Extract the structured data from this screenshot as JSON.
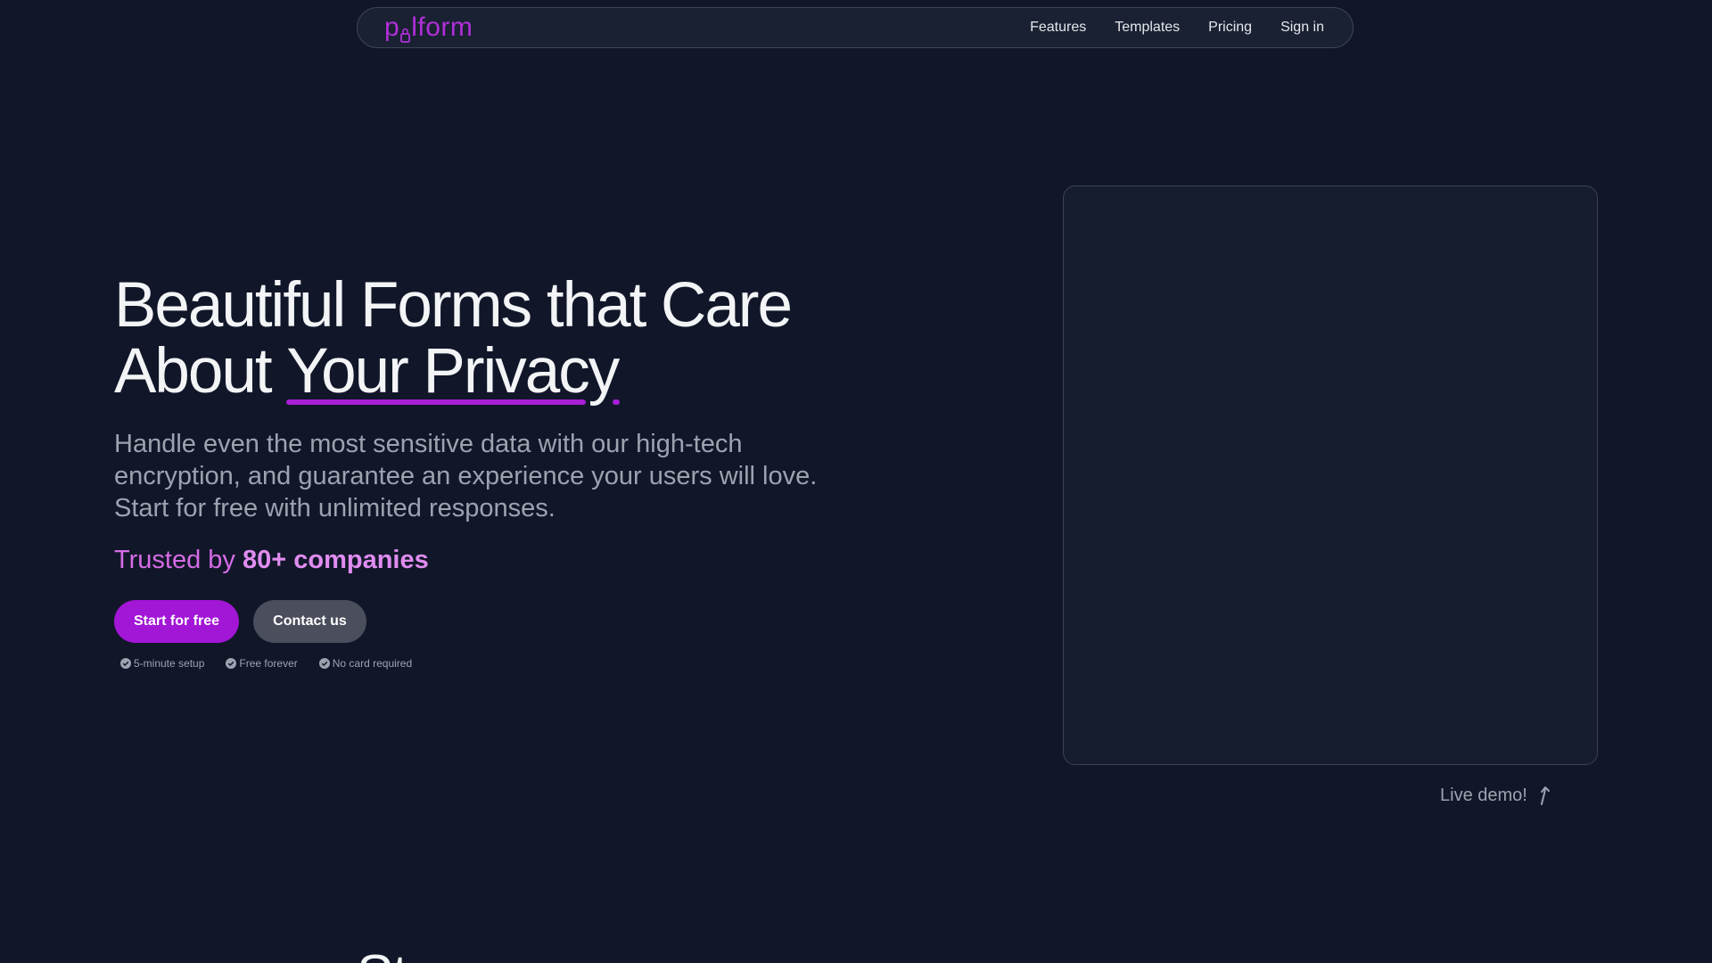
{
  "nav": {
    "logo_prefix": "p",
    "logo_suffix": "lform",
    "links": [
      "Features",
      "Templates",
      "Pricing",
      "Sign in"
    ]
  },
  "hero": {
    "title_line1": "Beautiful Forms that Care",
    "title_line2_plain": "About ",
    "title_line2_highlight": "Your Privacy",
    "subtitle": "Handle even the most sensitive data with our high-tech encryption, and guarantee an experience your users will love. Start for free with unlimited responses.",
    "trusted_prefix": "Trusted by ",
    "trusted_count": "80+ companies",
    "primary_button": "Start for free",
    "secondary_button": "Contact us",
    "perks": [
      "5-minute setup",
      "Free forever",
      "No card required"
    ]
  },
  "demo": {
    "label": "Live demo!"
  },
  "next_section": {
    "heading_partial": "St"
  },
  "colors": {
    "background": "#111729",
    "accent": "#a216d6",
    "accent_text": "#d66be6"
  },
  "icons": {
    "perk": "check-circle-icon",
    "live_demo": "arrow-up-curved-icon",
    "logo_glyph": "lock-icon"
  }
}
